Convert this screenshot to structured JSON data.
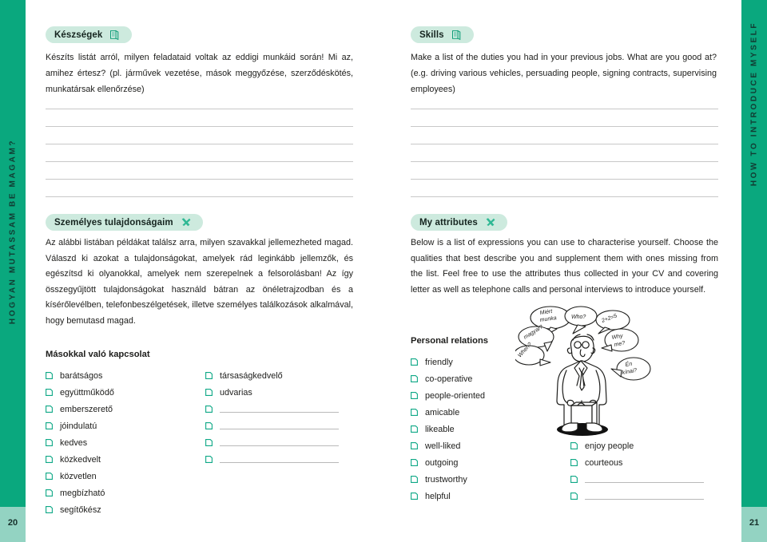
{
  "page": {
    "left_page_number": "20",
    "right_page_number": "21",
    "left_side_label": "HOGYAN MUTASSAM BE MAGAM?",
    "right_side_label": "HOW TO INTRODUCE MYSELF",
    "accent_color": "#0aa87e",
    "pill_color": "#cdeade",
    "page_box_color": "#93d3c2",
    "rule_color": "#c8c8c8"
  },
  "hungarian": {
    "skills": {
      "pill_label": "Készségek",
      "icon": "book-icon",
      "intro": "Készíts listát arról, milyen feladataid voltak az eddigi munkáid során! Mi az, amihez értesz? (pl. járművek vezetése, mások meggyőzése, szerződéskötés, munkatársak ellenőrzése)",
      "blank_line_count": 6
    },
    "attributes": {
      "pill_label": "Személyes tulajdonságaim",
      "icon": "x-mark-icon",
      "body": "Az alábbi listában példákat találsz arra, milyen szavakkal jellemezheted magad. Válaszd ki azokat a tulajdonságokat, amelyek rád leginkább jellemzők, és egészítsd ki olyanokkal, amelyek nem szerepelnek a felsorolásban! Az így összegyűjtött tulajdonságokat használd bátran az önéletrajzodban és a kísérőlevélben, telefonbeszélgetések, illetve személyes találkozások alkalmával, hogy bemutasd magad."
    },
    "list": {
      "heading": "Másokkal való kapcsolat",
      "column_one": [
        "barátságos",
        "együttműködő",
        "emberszerető",
        "jóindulatú",
        "kedves",
        "közkedvelt",
        "közvetlen",
        "megbízható",
        "segítőkész"
      ],
      "column_two": [
        "társaságkedvelő",
        "udvarias",
        "",
        "",
        "",
        ""
      ]
    }
  },
  "english": {
    "skills": {
      "pill_label": "Skills",
      "icon": "book-icon",
      "intro": "Make a list of the duties you had in your previous jobs. What are you good at? (e.g. driving various vehicles, persuading people, signing contracts, supervising employees)",
      "blank_line_count": 6
    },
    "attributes": {
      "pill_label": "My attributes",
      "icon": "x-mark-icon",
      "body": "Below is a list of expressions you can use to characterise yourself. Choose the qualities that best describe you and supplement them with ones missing from the list. Feel free to use the attributes thus collected in your CV and covering letter as well as telephone calls and personal interviews to introduce yourself."
    },
    "list": {
      "heading": "Personal relations",
      "column_one": [
        "friendly",
        "co-operative",
        "people-oriented",
        "amicable",
        "likeable",
        "well-liked",
        "outgoing",
        "trustworthy",
        "helpful"
      ],
      "column_two": [
        "enjoy people",
        "courteous",
        "",
        ""
      ]
    }
  },
  "cartoon": {
    "name": "confused-businessman-illustration",
    "speech_bubbles": [
      "Miért munka?",
      "magyar?",
      "Who?",
      "2+2=5",
      "Why me?",
      "When?",
      "Én kínai?"
    ]
  }
}
